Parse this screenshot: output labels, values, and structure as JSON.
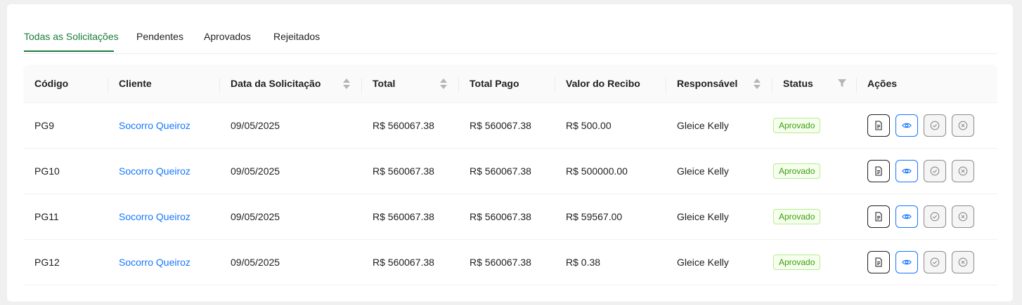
{
  "tabs": [
    {
      "label": "Todas as Solicitações",
      "active": true
    },
    {
      "label": "Pendentes",
      "active": false
    },
    {
      "label": "Aprovados",
      "active": false
    },
    {
      "label": "Rejeitados",
      "active": false
    }
  ],
  "columns": {
    "codigo": "Código",
    "cliente": "Cliente",
    "data": "Data da Solicitação",
    "total": "Total",
    "total_pago": "Total Pago",
    "valor_recibo": "Valor do Recibo",
    "responsavel": "Responsável",
    "status": "Status",
    "acoes": "Ações"
  },
  "rows": [
    {
      "codigo": "PG9",
      "cliente": "Socorro Queiroz",
      "data": "09/05/2025",
      "total": "R$ 560067.38",
      "total_pago": "R$ 560067.38",
      "valor_recibo": "R$ 500.00",
      "responsavel": "Gleice Kelly",
      "status": "Aprovado"
    },
    {
      "codigo": "PG10",
      "cliente": "Socorro Queiroz",
      "data": "09/05/2025",
      "total": "R$ 560067.38",
      "total_pago": "R$ 560067.38",
      "valor_recibo": "R$ 500000.00",
      "responsavel": "Gleice Kelly",
      "status": "Aprovado"
    },
    {
      "codigo": "PG11",
      "cliente": "Socorro Queiroz",
      "data": "09/05/2025",
      "total": "R$ 560067.38",
      "total_pago": "R$ 560067.38",
      "valor_recibo": "R$ 59567.00",
      "responsavel": "Gleice Kelly",
      "status": "Aprovado"
    },
    {
      "codigo": "PG12",
      "cliente": "Socorro Queiroz",
      "data": "09/05/2025",
      "total": "R$ 560067.38",
      "total_pago": "R$ 560067.38",
      "valor_recibo": "R$ 0.38",
      "responsavel": "Gleice Kelly",
      "status": "Aprovado"
    }
  ],
  "action_icons": [
    "document-icon",
    "eye-icon",
    "check-circle-icon",
    "close-circle-icon"
  ],
  "colors": {
    "accent": "#1a7a3c",
    "link": "#1677ff",
    "status_approved_text": "#389e0d",
    "status_approved_border": "#b7eb8f",
    "status_approved_bg": "#f6ffed"
  }
}
